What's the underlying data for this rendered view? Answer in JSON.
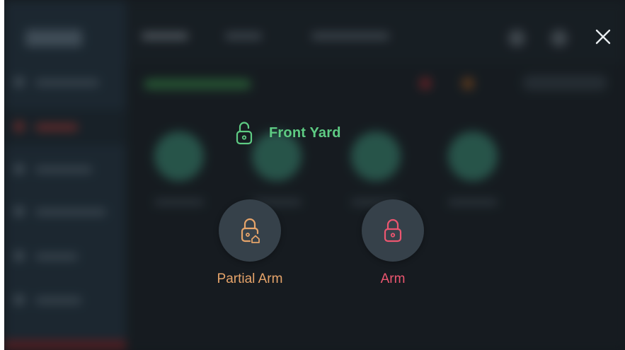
{
  "modal": {
    "zone_name": "Front Yard",
    "zone_status_icon": "unlocked-padlock-icon",
    "close_icon": "close-icon",
    "actions": [
      {
        "label": "Partial Arm",
        "icon": "partial-arm-lock-icon",
        "color": "#e6a46a"
      },
      {
        "label": "Arm",
        "icon": "lock-icon",
        "color": "#ec5670"
      }
    ]
  },
  "colors": {
    "zone_title": "#5ecb83",
    "button_bg": "#36414a",
    "backdrop": "#1d2226"
  }
}
